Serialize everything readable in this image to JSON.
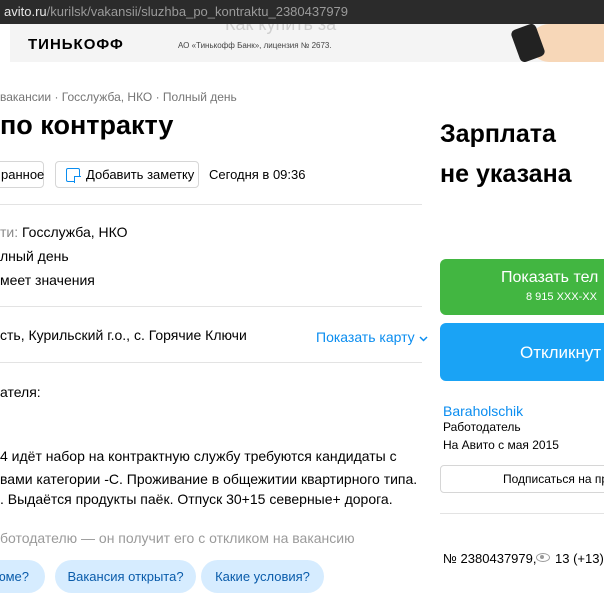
{
  "browser": {
    "url_host": "avito.ru",
    "url_path": "/kurilsk/vakansii/sluzhba_po_kontraktu_2380437979"
  },
  "banner": {
    "brand": "ТИНЬКОФФ",
    "legal": "АО «Тинькофф Банк», лицензия № 2673.",
    "ghost_text": "Как купить за"
  },
  "breadcrumbs": "вакансии · Госслужба, НКО · Полный день",
  "title": "по контракту",
  "actions": {
    "favorite": "ранное",
    "add_note": "Добавить заметку",
    "date": "Сегодня в 09:36"
  },
  "params": [
    {
      "label": "ти: ",
      "value": "Госслужба, НКО"
    },
    {
      "label": "",
      "value": "лный день"
    },
    {
      "label": "",
      "value": "меет значения"
    }
  ],
  "location": {
    "address": "сть, Курильский г.о., с. Горячие Ключи",
    "show_map": "Показать карту"
  },
  "description": {
    "heading": "ателя:",
    "lines": [
      "4 идёт набор на контрактную службу требуются кандидаты с",
      "вами категории -С. Проживание в общежитии квартирного типа.",
      ". Выдаётся продукты паёк. Отпуск 30+15 северные+ дорога."
    ]
  },
  "questions": {
    "hint": "ботодателю — он получит его с откликом на вакансию",
    "chips": [
      "юме?",
      "Вакансия открыта?",
      "Какие условия?"
    ]
  },
  "sidebar": {
    "salary_line1": "Зарплата",
    "salary_line2": "не указана",
    "show_phone": "Показать тел",
    "phone_masked": "8 915 XXX-XX",
    "respond": "Откликнут",
    "seller_name": "Baraholschik",
    "seller_role": "Работодатель",
    "seller_since": "На Авито с мая 2015",
    "subscribe": "Подписаться на пр",
    "ad_number": "№ 2380437979,",
    "views": "13 (+13)"
  },
  "colors": {
    "accent_blue": "#0a8df0",
    "green_button": "#42b641",
    "blue_button": "#1aa3f5",
    "chip_bg": "#d6ecff"
  }
}
